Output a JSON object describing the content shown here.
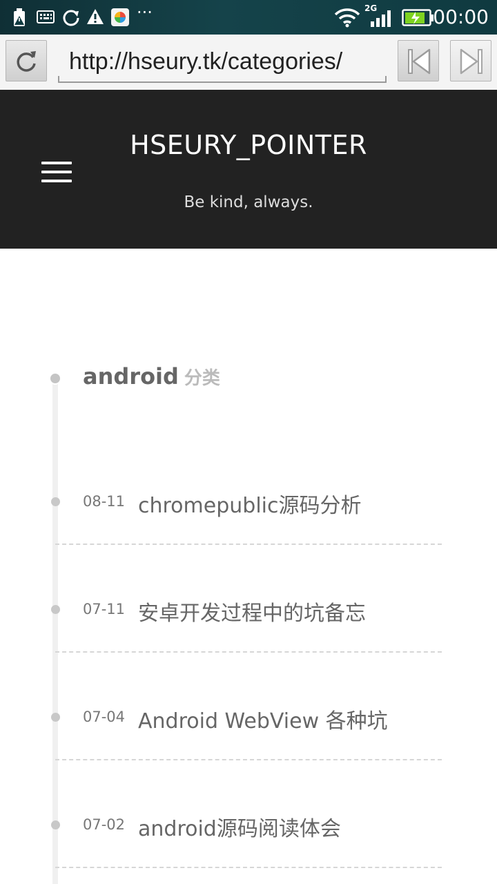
{
  "status_bar": {
    "time": "00:00",
    "network_type": "2G",
    "more": "···",
    "icons": [
      "battery-alert-icon",
      "keyboard-icon",
      "sync-icon",
      "warning-icon",
      "app-icon",
      "wifi-icon",
      "signal-icon",
      "battery-charging-icon"
    ]
  },
  "toolbar": {
    "url": "http://hseury.tk/categories/",
    "reload_icon": "reload-icon",
    "back_icon": "skip-back-icon",
    "forward_icon": "skip-forward-icon"
  },
  "header": {
    "title": "HSEURY_POINTER",
    "subtitle": "Be kind, always.",
    "menu_icon": "hamburger-menu-icon"
  },
  "category": {
    "name": "android",
    "suffix": "分类"
  },
  "posts": [
    {
      "date": "08-11",
      "title": "chromepublic源码分析"
    },
    {
      "date": "07-11",
      "title": "安卓开发过程中的坑备忘"
    },
    {
      "date": "07-04",
      "title": "Android WebView 各种坑"
    },
    {
      "date": "07-02",
      "title": "android源码阅读体会"
    }
  ],
  "colors": {
    "status_bar": "#0f3a40",
    "header_bg": "#222222",
    "text_muted": "#666666",
    "timeline": "#f0f0f0"
  }
}
